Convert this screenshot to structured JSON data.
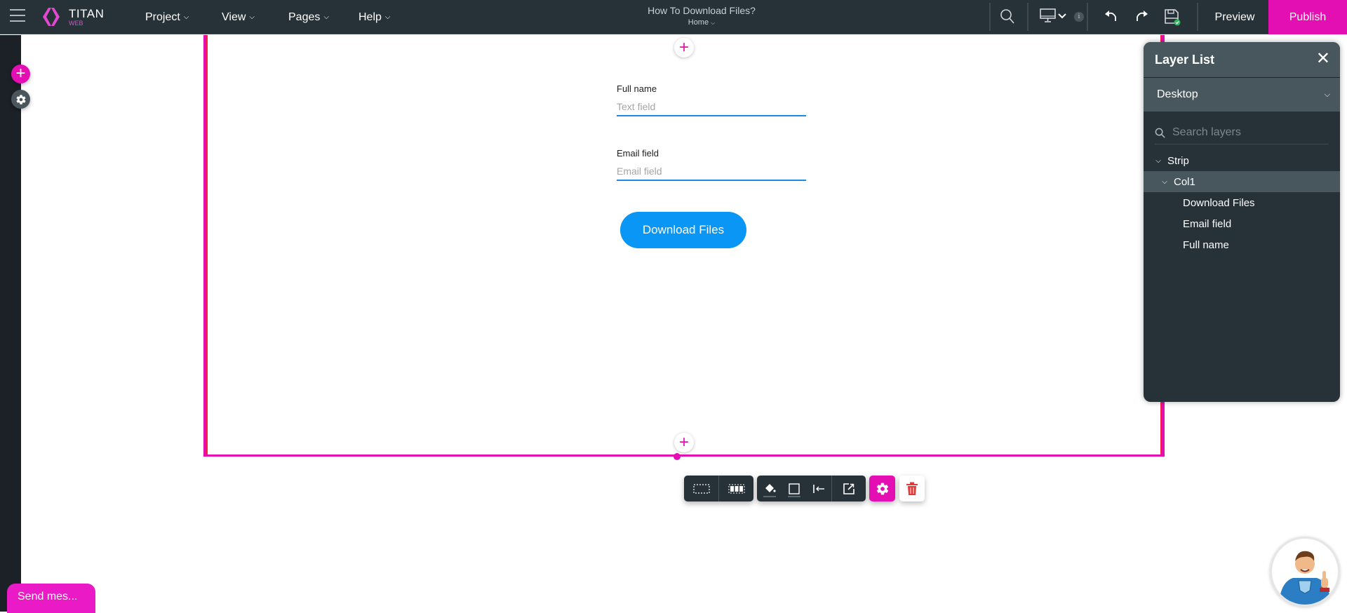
{
  "topbar": {
    "logo": {
      "title": "TITAN",
      "subtitle": "WEB"
    },
    "menus": [
      {
        "label": "Project"
      },
      {
        "label": "View"
      },
      {
        "label": "Pages"
      },
      {
        "label": "Help"
      }
    ],
    "document_title": "How To Download Files?",
    "current_page": "Home",
    "icons": [
      "hamburger-icon",
      "search-icon",
      "desktop-icon",
      "chevron-down-icon",
      "info-icon",
      "undo-icon",
      "redo-icon",
      "save-icon"
    ],
    "preview_label": "Preview",
    "publish_label": "Publish",
    "info_glyph": "i"
  },
  "left_rail": {
    "add_glyph": "+"
  },
  "canvas": {
    "add_glyph": "+",
    "form": {
      "full_name": {
        "label": "Full name",
        "placeholder": "Text field",
        "value": ""
      },
      "email": {
        "label": "Email field",
        "placeholder": "Email field",
        "value": ""
      },
      "button_label": "Download Files"
    }
  },
  "element_toolbar": {
    "items": [
      "select-strip",
      "select-columns",
      "fill",
      "border",
      "align-left",
      "open-link",
      "settings",
      "delete"
    ]
  },
  "layer_panel": {
    "title": "Layer List",
    "close_glyph": "✕",
    "device": "Desktop",
    "search_placeholder": "Search layers",
    "tree": [
      {
        "label": "Strip",
        "level": 0,
        "expanded": true,
        "selected": false
      },
      {
        "label": "Col1",
        "level": 1,
        "expanded": true,
        "selected": true
      },
      {
        "label": "Download Files",
        "level": 2,
        "selected": false
      },
      {
        "label": "Email field",
        "level": 2,
        "selected": false
      },
      {
        "label": "Full name",
        "level": 2,
        "selected": false
      }
    ]
  },
  "chat": {
    "label": "Send mes..."
  },
  "colors": {
    "accent": "#e30fb2",
    "topbar": "#263238",
    "button_blue": "#0a96f4",
    "input_underline": "#1e88e5",
    "panel_header": "#48575e"
  }
}
